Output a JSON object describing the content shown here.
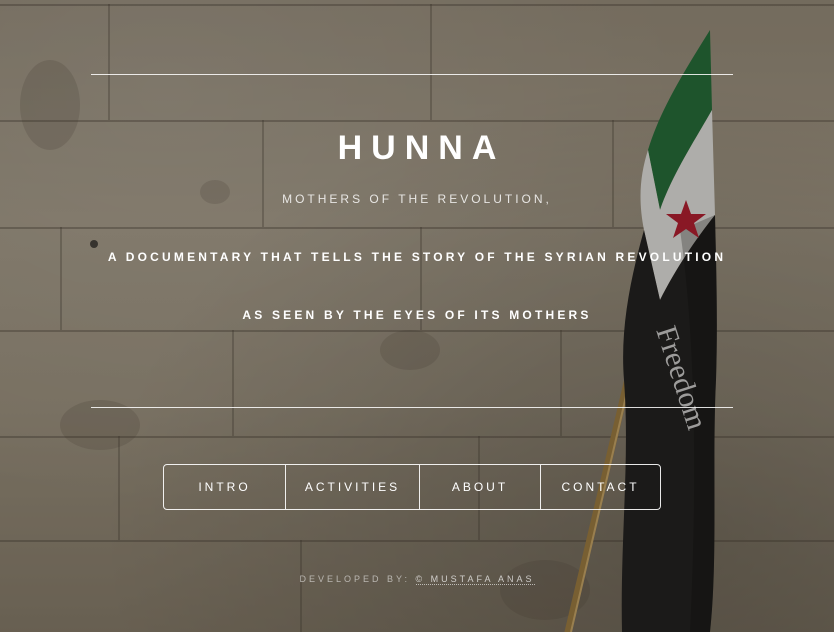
{
  "header": {
    "title": "HUNNA",
    "subtitle": "MOTHERS OF THE REVOLUTION,",
    "tagline_line1": "A DOCUMENTARY THAT TELLS THE STORY OF THE SYRIAN REVOLUTION",
    "tagline_line2": "AS SEEN BY THE EYES OF ITS MOTHERS"
  },
  "nav": {
    "items": [
      {
        "label": "INTRO"
      },
      {
        "label": "ACTIVITIES"
      },
      {
        "label": "ABOUT"
      },
      {
        "label": "CONTACT"
      }
    ]
  },
  "footer": {
    "prefix": "DEVELOPED BY:",
    "credit_link": "© MUSTAFA ANAS"
  },
  "background": {
    "flag_text": "Freedom",
    "colors": {
      "flag_green": "#1f6b35",
      "flag_white": "#e8e8e6",
      "flag_black": "#1b1b1b",
      "flag_star": "#b3182b",
      "wall": "#9b917e"
    }
  }
}
